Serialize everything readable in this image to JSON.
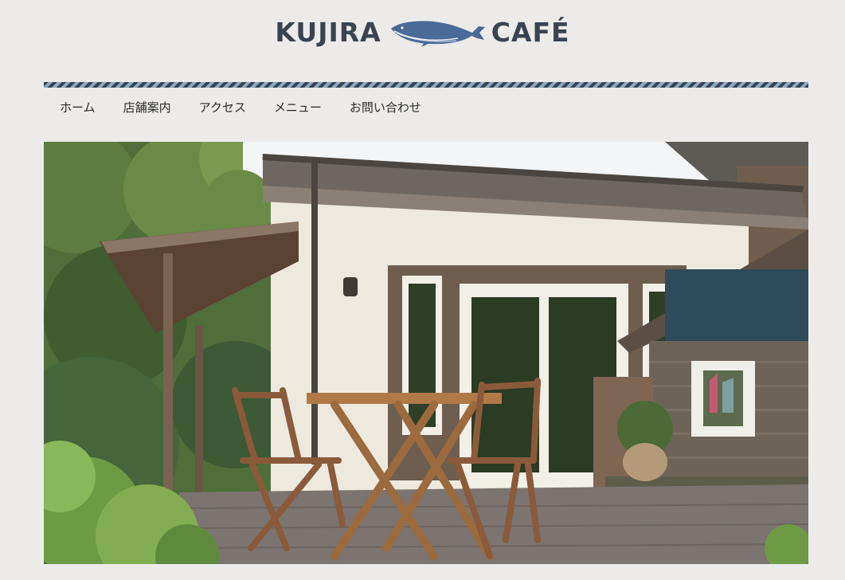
{
  "brand": {
    "left_word": "KUJIRA",
    "right_word": "CAFÉ",
    "text_color": "#3a4350",
    "whale_color": "#4a6a97",
    "icon": "whale-icon"
  },
  "nav": {
    "items": [
      {
        "label": "ホーム"
      },
      {
        "label": "店舗案内"
      },
      {
        "label": "アクセス"
      },
      {
        "label": "メニュー"
      },
      {
        "label": "お問い合わせ"
      }
    ]
  },
  "colors": {
    "background": "#ecebe9",
    "rule_dark": "#3a4350",
    "rule_light": "#8aa9c4"
  },
  "hero": {
    "image": "cafe-exterior-photo"
  }
}
